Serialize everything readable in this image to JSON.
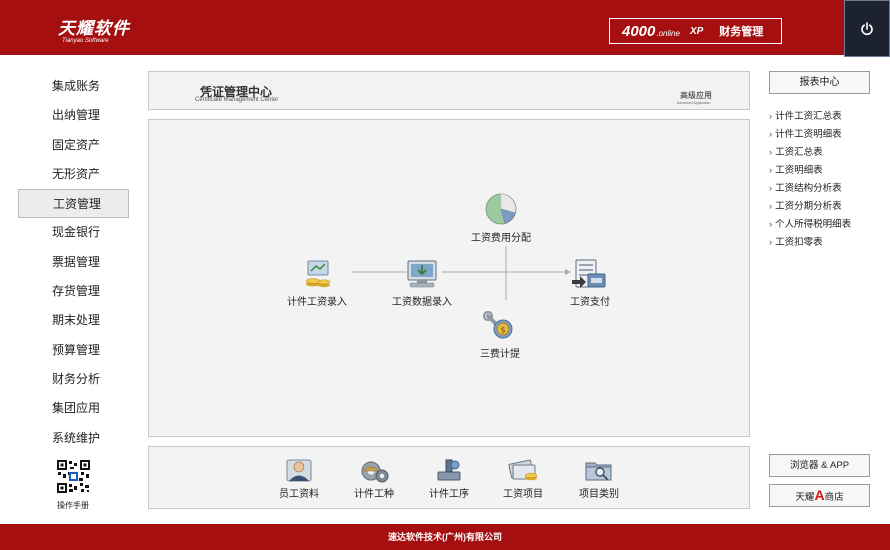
{
  "header": {
    "logo_main": "天耀软件",
    "logo_sub": "Tianyao Software",
    "product_number": "4000",
    "product_suffix": ".online",
    "product_edition": "XP",
    "product_name": "财务管理"
  },
  "nav": {
    "items": [
      {
        "label": "集成账务"
      },
      {
        "label": "出纳管理"
      },
      {
        "label": "固定资产"
      },
      {
        "label": "无形资产"
      },
      {
        "label": "工资管理"
      },
      {
        "label": "现金银行"
      },
      {
        "label": "票据管理"
      },
      {
        "label": "存货管理"
      },
      {
        "label": "期末处理"
      },
      {
        "label": "预算管理"
      },
      {
        "label": "财务分析"
      },
      {
        "label": "集团应用"
      },
      {
        "label": "系统维护"
      }
    ],
    "active_index": 4,
    "manual_label": "操作手册"
  },
  "title_bar": {
    "title_cn": "凭证管理中心",
    "title_en": "Certificate Management Center",
    "advanced_cn": "高级应用",
    "advanced_en": "Advanced Application"
  },
  "flow": {
    "piece_wage_entry": "计件工资录入",
    "wage_data_entry": "工资数据录入",
    "wage_cost_allocation": "工资费用分配",
    "three_fees_accrual": "三费计提",
    "wage_payment": "工资支付"
  },
  "toolbar": {
    "items": [
      {
        "label": "员工资料",
        "icon": "employee-icon"
      },
      {
        "label": "计件工种",
        "icon": "work-type-icon"
      },
      {
        "label": "计件工序",
        "icon": "process-icon"
      },
      {
        "label": "工资项目",
        "icon": "wage-item-icon"
      },
      {
        "label": "项目类别",
        "icon": "category-icon"
      }
    ]
  },
  "reports": {
    "button_label": "报表中心",
    "items": [
      {
        "label": "计件工资汇总表"
      },
      {
        "label": "计件工资明细表"
      },
      {
        "label": "工资汇总表"
      },
      {
        "label": "工资明细表"
      },
      {
        "label": "工资结构分析表"
      },
      {
        "label": "工资分期分析表"
      },
      {
        "label": "个人所得税明细表"
      },
      {
        "label": "工资扣零表"
      }
    ]
  },
  "side_buttons": {
    "browser_label": "浏览器 & APP",
    "store_prefix": "天耀",
    "store_letter": "A",
    "store_suffix": "商店"
  },
  "footer": {
    "company": "速达软件技术(广州)有限公司"
  },
  "colors": {
    "brand_red": "#a50f10",
    "power_bg": "#1c2230"
  }
}
